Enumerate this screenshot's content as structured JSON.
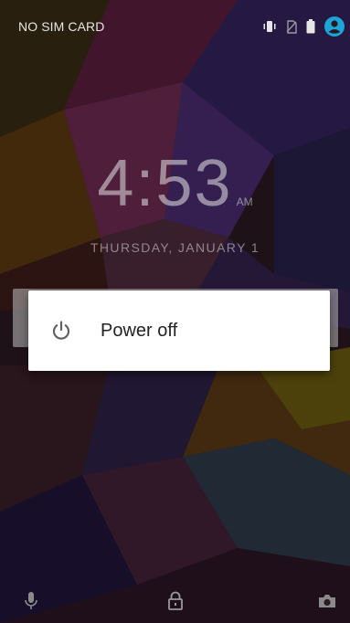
{
  "status_bar": {
    "carrier_text": "NO SIM CARD",
    "icons": [
      "vibrate-icon",
      "no-sim-icon",
      "battery-icon",
      "user-account-icon"
    ]
  },
  "lockscreen": {
    "time": "4:53",
    "ampm": "AM",
    "date": "THURSDAY, JANUARY 1"
  },
  "power_dialog": {
    "items": [
      {
        "icon": "power-icon",
        "label": "Power off"
      }
    ]
  },
  "bottom_bar": {
    "icons": [
      "microphone-icon",
      "lock-icon",
      "camera-icon"
    ]
  },
  "colors": {
    "account_accent": "#1da5d8",
    "dialog_bg": "#ffffff",
    "dialog_text": "#222222"
  }
}
